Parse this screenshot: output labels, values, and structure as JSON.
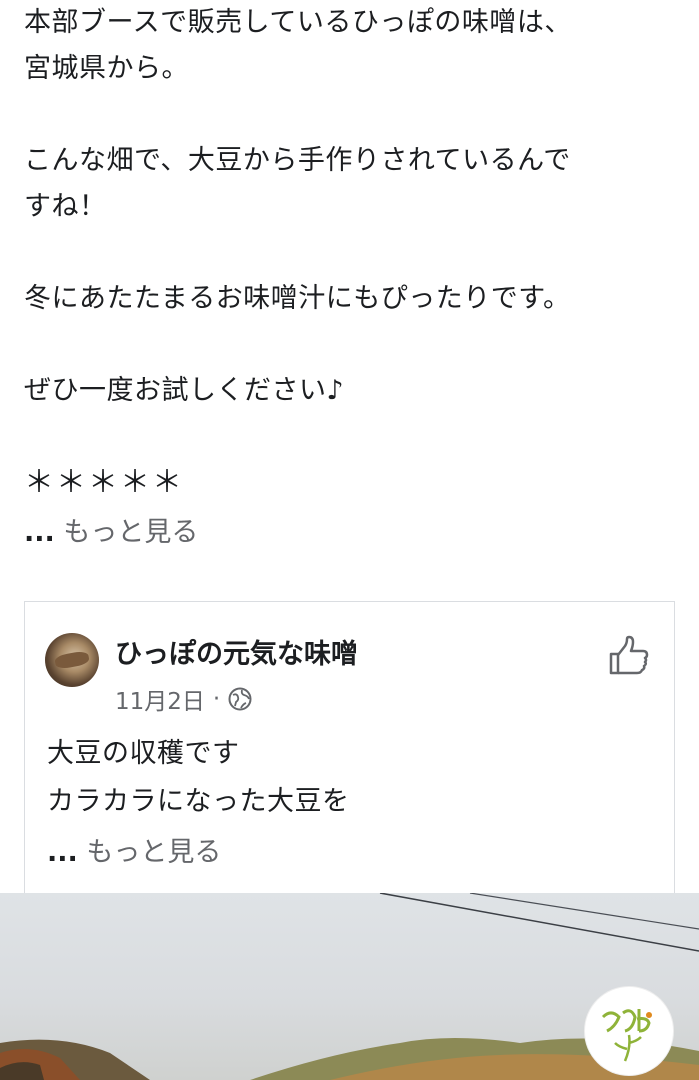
{
  "post": {
    "lines": [
      "本部ブースで販売しているひっぽの味噌は、",
      "宮城県から。",
      "こんな畑で、大豆から手作りされているんで",
      "すね！",
      "冬にあたたまるお味噌汁にもぴったりです。",
      "ぜひ一度お試しください♪",
      "＊＊＊＊＊"
    ],
    "more_dots": "...",
    "more_label": "もっと見る"
  },
  "shared_post": {
    "page_name": "ひっぽの元気な味噌",
    "date": "11月2日",
    "separator": "·",
    "audience_icon": "globe-icon",
    "like_icon": "thumbs-up-icon",
    "lines": [
      "大豆の収穫です",
      "カラカラになった大豆を"
    ],
    "more_dots": "...",
    "more_label": "もっと見る"
  },
  "photo": {
    "logo_icon": "marche-logo"
  },
  "colors": {
    "text": "#1c1e21",
    "muted": "#65676b",
    "border": "#dadde1",
    "logo_green": "#8fb339",
    "logo_orange": "#e08a1e"
  }
}
